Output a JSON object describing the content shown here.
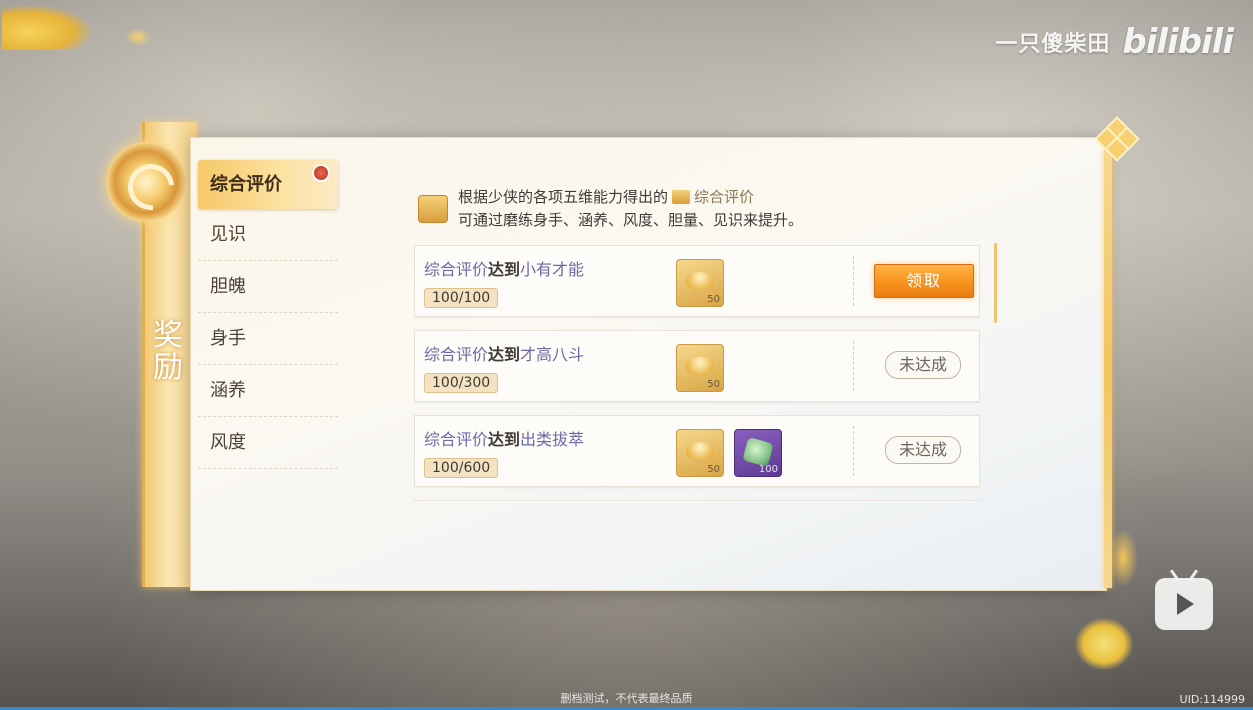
{
  "watermark": {
    "author": "一只傻柴田",
    "site": "bilibili"
  },
  "side_title": "奖励",
  "sidebar": {
    "items": [
      {
        "label": "综合评价",
        "active": true
      },
      {
        "label": "见识"
      },
      {
        "label": "胆魄"
      },
      {
        "label": "身手"
      },
      {
        "label": "涵养"
      },
      {
        "label": "风度"
      }
    ]
  },
  "description": {
    "line1_prefix": "根据少侠的各项五维能力得出的",
    "line1_highlight": "综合评价",
    "line2": "可通过磨练身手、涵养、风度、胆量、见识来提升。"
  },
  "tasks": [
    {
      "prefix": "综合评价",
      "mid": "达到",
      "target": "小有才能",
      "progress": "100/100",
      "rewards": [
        {
          "icon": "gold-ingot-icon",
          "qty": "50"
        }
      ],
      "action": "领取"
    },
    {
      "prefix": "综合评价",
      "mid": "达到",
      "target": "才高八斗",
      "progress": "100/300",
      "rewards": [
        {
          "icon": "gold-ingot-icon",
          "qty": "50"
        }
      ],
      "status": "未达成"
    },
    {
      "prefix": "综合评价",
      "mid": "达到",
      "target": "出类拔萃",
      "progress": "100/600",
      "rewards": [
        {
          "icon": "gold-ingot-icon",
          "qty": "50"
        },
        {
          "icon": "jade-icon",
          "qty": "100"
        }
      ],
      "status": "未达成"
    }
  ],
  "footer_note": "删档测试，不代表最终品质",
  "uid": "UID:114999",
  "colors": {
    "accent": "#f7941d",
    "panel": "#fbf6ea",
    "gold": "#f3c45f",
    "keyword": "#6a6aa8"
  }
}
